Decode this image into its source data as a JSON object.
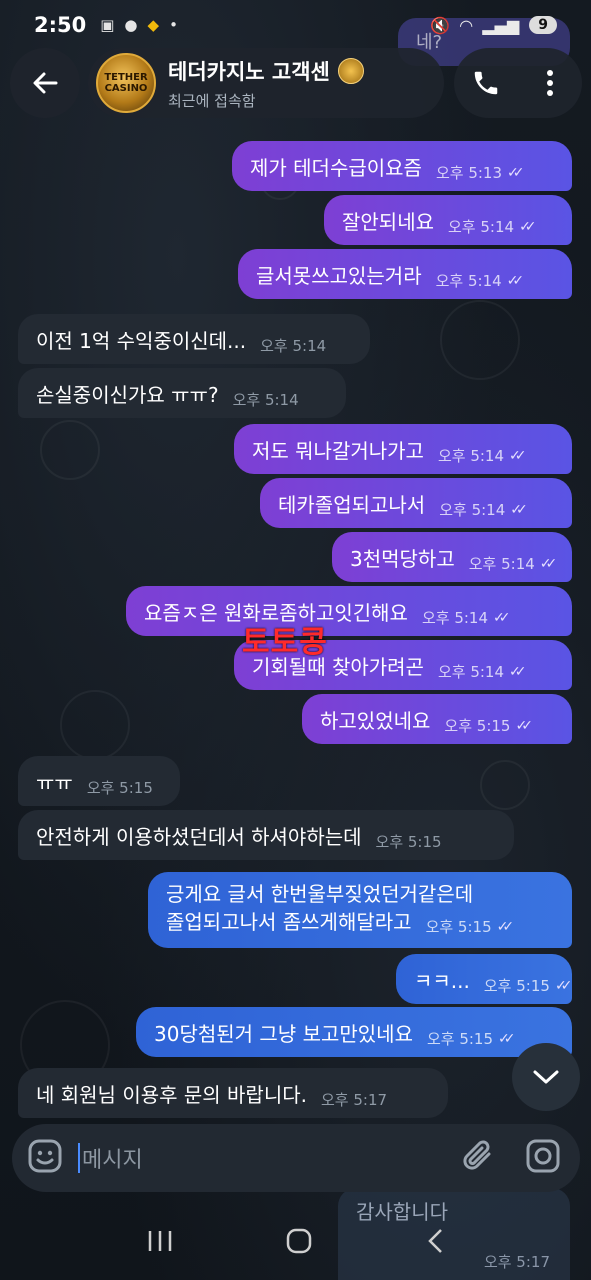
{
  "status": {
    "time": "2:50",
    "battery": "9"
  },
  "header": {
    "title": "테더카지노 고객센",
    "subtitle": "최근에 접속함",
    "avatar_text": "TETHER CASINO",
    "peek_text": "네?"
  },
  "messages": [
    {
      "dir": "out",
      "color": "purple",
      "text": "제가 테더수급이요즘",
      "time": "오후 5:13"
    },
    {
      "dir": "out",
      "color": "purple",
      "text": "잘안되네요",
      "time": "오후 5:14"
    },
    {
      "dir": "out",
      "color": "purple",
      "text": "글서못쓰고있는거라",
      "time": "오후 5:14"
    },
    {
      "dir": "in",
      "text": "이전 1억 수익중이신데...",
      "time": "오후 5:14"
    },
    {
      "dir": "in",
      "text": "손실중이신가요 ㅠㅠ?",
      "time": "오후 5:14"
    },
    {
      "dir": "out",
      "color": "purple",
      "text": "저도 뭐나갈거나가고",
      "time": "오후 5:14"
    },
    {
      "dir": "out",
      "color": "purple",
      "text": "테카졸업되고나서",
      "time": "오후 5:14"
    },
    {
      "dir": "out",
      "color": "purple",
      "text": "3천먹당하고",
      "time": "오후 5:14"
    },
    {
      "dir": "out",
      "color": "purple",
      "text": "요즘ㅈ은 원화로좀하고잇긴해요",
      "time": "오후 5:14"
    },
    {
      "dir": "out",
      "color": "purple",
      "text": "기회될때 찾아가려곤",
      "time": "오후 5:14"
    },
    {
      "dir": "out",
      "color": "purple",
      "text": "하고있었네요",
      "time": "오후 5:15"
    },
    {
      "dir": "in",
      "text": "ㅠㅠ",
      "time": "오후 5:15"
    },
    {
      "dir": "in",
      "text": "안전하게 이용하셨던데서 하셔야하는데",
      "time": "오후 5:15"
    },
    {
      "dir": "out",
      "color": "blue",
      "line1": "긍게요 글서 한번울부짖었던거같은데",
      "text": "졸업되고나서 좀쓰게해달라고",
      "time": "오후 5:15"
    },
    {
      "dir": "out",
      "color": "blue",
      "text": "ㅋㅋ...",
      "time": "오후 5:15"
    },
    {
      "dir": "out",
      "color": "blue",
      "text": "30당첨된거 그냥 보고만있네요",
      "time": "오후 5:15"
    },
    {
      "dir": "in",
      "text": "네 회원님 이용후 문의 바랍니다.",
      "time": "오후 5:17"
    }
  ],
  "watermark": "토토콩",
  "input": {
    "placeholder": "메시지"
  },
  "peek": {
    "text": "감사합니다",
    "time": "오후 5:17"
  },
  "colors": {
    "out_purple": "#7e3fd4",
    "out_blue": "#2f63d6",
    "incoming": "#232a33",
    "watermark": "#ff2a2a"
  }
}
